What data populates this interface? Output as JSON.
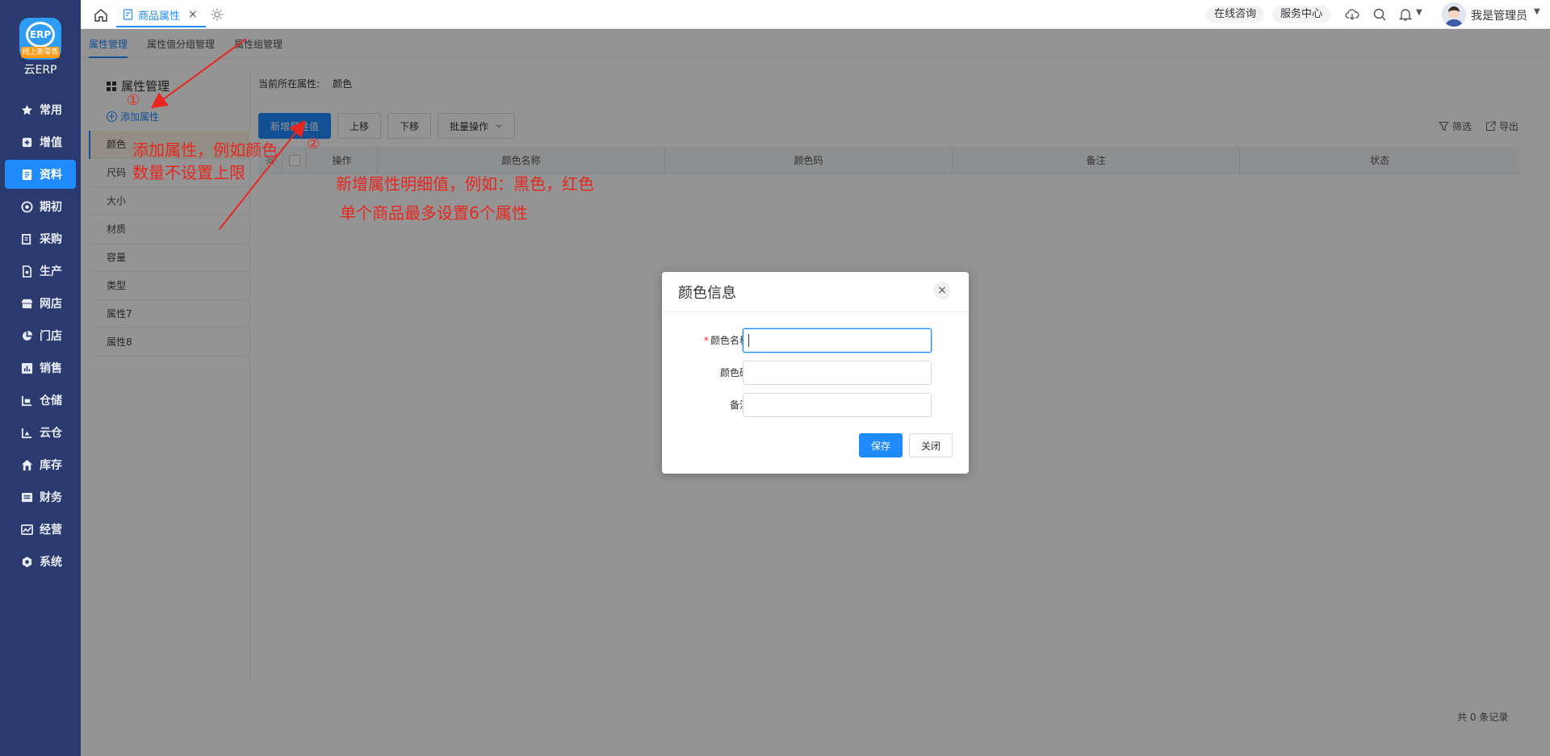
{
  "app": {
    "logo_text": "云ERP",
    "logo_ribbon": "线上新零售",
    "logo_mark": "ERP"
  },
  "sidebar": {
    "items": [
      {
        "label": "常用",
        "icon": "star-icon"
      },
      {
        "label": "增值",
        "icon": "plus-square-icon"
      },
      {
        "label": "资料",
        "icon": "document-icon",
        "active": true
      },
      {
        "label": "期初",
        "icon": "target-icon"
      },
      {
        "label": "采购",
        "icon": "purchase-icon"
      },
      {
        "label": "生产",
        "icon": "production-icon"
      },
      {
        "label": "网店",
        "icon": "shop-icon"
      },
      {
        "label": "门店",
        "icon": "pie-chart-icon"
      },
      {
        "label": "销售",
        "icon": "bar-chart-icon"
      },
      {
        "label": "仓储",
        "icon": "warehouse-icon"
      },
      {
        "label": "云仓",
        "icon": "cloud-warehouse-icon"
      },
      {
        "label": "库存",
        "icon": "home-icon"
      },
      {
        "label": "财务",
        "icon": "finance-icon"
      },
      {
        "label": "经营",
        "icon": "operation-icon"
      },
      {
        "label": "系统",
        "icon": "settings-icon"
      }
    ]
  },
  "topbar": {
    "tab_label": "商品属性",
    "tab_close": "×",
    "online_consult": "在线咨询",
    "service_center": "服务中心",
    "username": "我是管理员",
    "caret": "▼"
  },
  "subtabs": [
    "属性管理",
    "属性值分组管理",
    "属性组管理"
  ],
  "left_panel": {
    "title": "属性管理",
    "add_label": "添加属性",
    "add_icon": "+",
    "items": [
      "颜色",
      "尺码",
      "大小",
      "材质",
      "容量",
      "类型",
      "属性7",
      "属性8"
    ]
  },
  "content": {
    "current_label": "当前所在属性:",
    "current_value": "颜色",
    "buttons": {
      "add_value": "新增属性值",
      "move_up": "上移",
      "move_down": "下移",
      "batch": "批量操作"
    },
    "filter": "筛选",
    "export": "导出",
    "columns": [
      "操作",
      "颜色名称",
      "颜色码",
      "备注",
      "状态"
    ],
    "record_count": "共 0 条记录"
  },
  "dialog": {
    "title": "颜色信息",
    "close": "×",
    "required_mark": "*",
    "fields": [
      {
        "label": "颜色名称:",
        "value": "",
        "required": true
      },
      {
        "label": "颜色码:",
        "value": ""
      },
      {
        "label": "备注:",
        "value": ""
      }
    ],
    "save": "保存",
    "close_button": "关闭"
  },
  "annotations": {
    "num1": "①",
    "num2": "②",
    "note1_line1": "添加属性，例如颜色",
    "note1_line2": "数量不设置上限",
    "note2_line1": "新增属性明细值，例如：黑色，红色",
    "note2_line2": "单个商品最多设置6个属性",
    "color": "#e8261f"
  },
  "colors": {
    "sidebar_bg": "#2a3a6e",
    "accent": "#1f8bff"
  }
}
